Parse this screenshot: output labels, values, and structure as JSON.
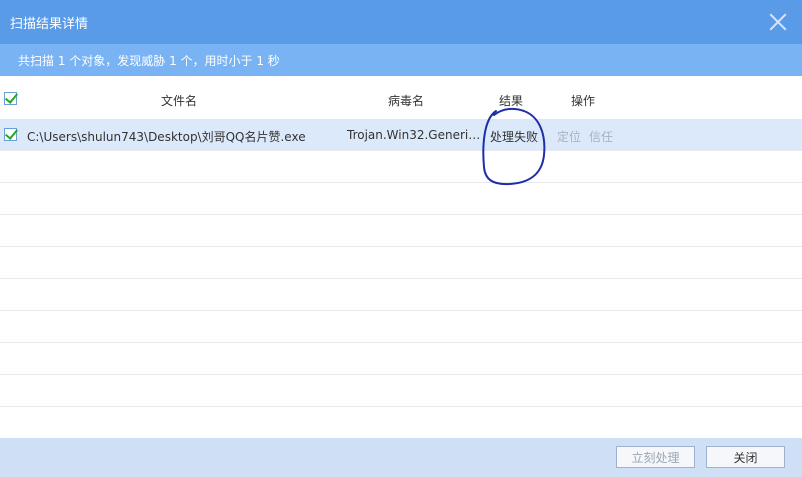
{
  "window": {
    "title": "扫描结果详情"
  },
  "summary": {
    "text": "共扫描 1 个对象，发现威胁 1 个，用时小于 1 秒"
  },
  "table": {
    "headers": {
      "file": "文件名",
      "virus": "病毒名",
      "result": "结果",
      "action": "操作"
    },
    "rows": [
      {
        "file": "C:\\Users\\shulun743\\Desktop\\刘哥QQ名片赞.exe",
        "virus": "Trojan.Win32.Generi…",
        "result": "处理失败",
        "actions": [
          "定位",
          "信任"
        ]
      }
    ]
  },
  "footer": {
    "process_now": "立刻处理",
    "close": "关闭"
  },
  "colors": {
    "titlebar": "#5a9be8",
    "summary_bar": "#7ab3f4",
    "selected_row": "#dbe9fb",
    "footer": "#cfe0f6",
    "annotation": "#1e2ea8"
  }
}
